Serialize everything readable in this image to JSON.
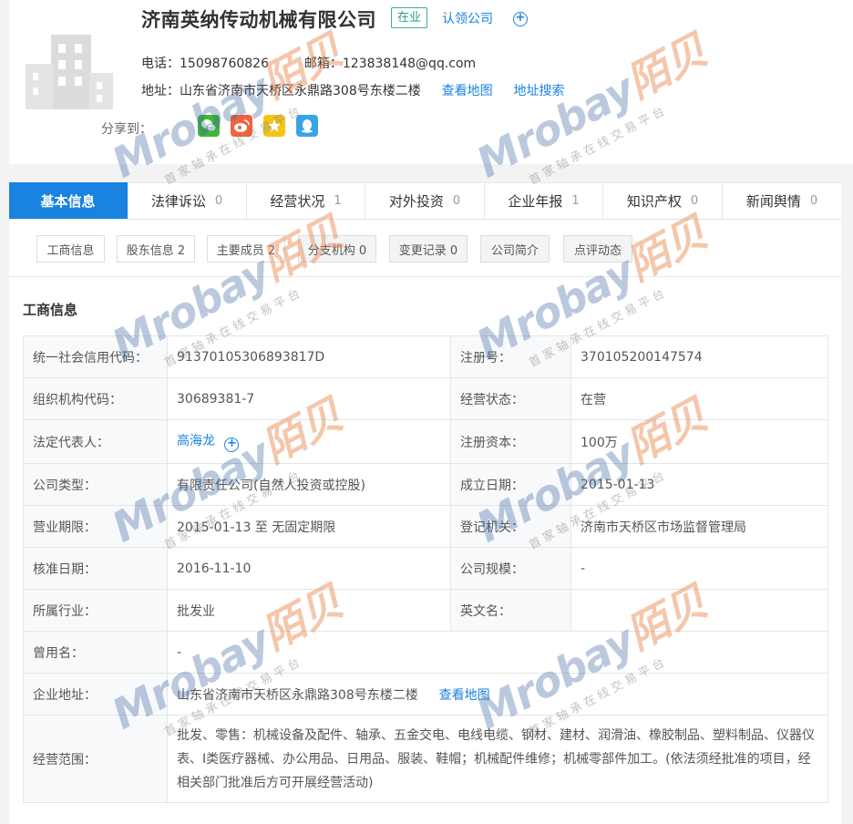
{
  "company": {
    "name": "济南英纳传动机械有限公司",
    "status": "在业",
    "claim_label": "认领公司",
    "phone_label": "电话：",
    "phone": "15098760826",
    "email_label": "邮箱：",
    "email": "123838148@qq.com",
    "address_label": "地址：",
    "address": "山东省济南市天桥区永鼎路308号东楼二楼",
    "view_map": "查看地图",
    "address_search": "地址搜索",
    "share_label": "分享到："
  },
  "tabs": [
    {
      "label": "基本信息",
      "count": ""
    },
    {
      "label": "法律诉讼",
      "count": "0"
    },
    {
      "label": "经营状况",
      "count": "1"
    },
    {
      "label": "对外投资",
      "count": "0"
    },
    {
      "label": "企业年报",
      "count": "1"
    },
    {
      "label": "知识产权",
      "count": "0"
    },
    {
      "label": "新闻舆情",
      "count": "0"
    }
  ],
  "subtabs": [
    "工商信息",
    "股东信息 2",
    "主要成员 2",
    "分支机构 0",
    "变更记录 0",
    "公司简介",
    "点评动态"
  ],
  "section_title": "工商信息",
  "info": {
    "credit_code_label": "统一社会信用代码：",
    "credit_code": "91370105306893817D",
    "reg_no_label": "注册号：",
    "reg_no": "370105200147574",
    "org_code_label": "组织机构代码：",
    "org_code": "30689381-7",
    "op_status_label": "经营状态：",
    "op_status": "在营",
    "legal_rep_label": "法定代表人：",
    "legal_rep": "高海龙",
    "capital_label": "注册资本：",
    "capital": "100万",
    "type_label": "公司类型：",
    "type": "有限责任公司(自然人投资或控股)",
    "founded_label": "成立日期：",
    "founded": "2015-01-13",
    "term_label": "营业期限：",
    "term": "2015-01-13 至 无固定期限",
    "authority_label": "登记机关：",
    "authority": "济南市天桥区市场监督管理局",
    "approved_label": "核准日期：",
    "approved": "2016-11-10",
    "scale_label": "公司规模：",
    "scale": "-",
    "industry_label": "所属行业：",
    "industry": "批发业",
    "english_label": "英文名：",
    "english": "",
    "former_label": "曾用名：",
    "former": "-",
    "addr_label": "企业地址：",
    "addr": "山东省济南市天桥区永鼎路308号东楼二楼",
    "addr_map": "查看地图",
    "scope_label": "经营范围：",
    "scope": "批发、零售：机械设备及配件、轴承、五金交电、电线电缆、钢材、建材、润滑油、橡胶制品、塑料制品、仪器仪表、Ⅰ类医疗器械、办公用品、日用品、服装、鞋帽；机械配件维修；机械零部件加工。(依法须经批准的项目，经相关部门批准后方可开展经营活动)"
  },
  "watermark": {
    "latin": "Mrobay",
    "cn": "陌贝",
    "slogan": "首家轴承在线交易平台"
  },
  "colors": {
    "accent": "#1a82e0",
    "status_green": "#28a07a"
  }
}
